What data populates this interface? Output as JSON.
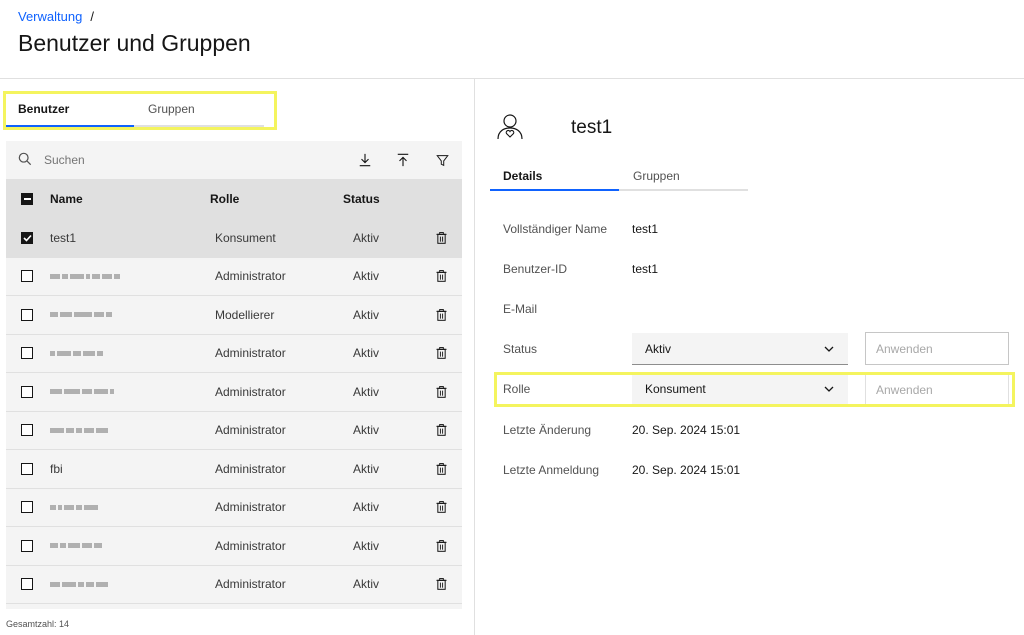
{
  "breadcrumb": {
    "root": "Verwaltung",
    "separator": "/"
  },
  "page_title": "Benutzer und Gruppen",
  "left_tabs": [
    {
      "label": "Benutzer",
      "active": true
    },
    {
      "label": "Gruppen",
      "active": false
    }
  ],
  "toolbar": {
    "search_placeholder": "Suchen",
    "download_icon": "download-icon",
    "upload_icon": "upload-icon",
    "filter_icon": "filter-icon"
  },
  "table": {
    "columns": {
      "name": "Name",
      "role": "Rolle",
      "status": "Status"
    },
    "rows": [
      {
        "name": "test1",
        "role": "Konsument",
        "status": "Aktiv",
        "checked": true,
        "redacted": false
      },
      {
        "name": "",
        "role": "Administrator",
        "status": "Aktiv",
        "checked": false,
        "redacted": true
      },
      {
        "name": "",
        "role": "Modellierer",
        "status": "Aktiv",
        "checked": false,
        "redacted": true
      },
      {
        "name": "",
        "role": "Administrator",
        "status": "Aktiv",
        "checked": false,
        "redacted": true
      },
      {
        "name": "",
        "role": "Administrator",
        "status": "Aktiv",
        "checked": false,
        "redacted": true
      },
      {
        "name": "",
        "role": "Administrator",
        "status": "Aktiv",
        "checked": false,
        "redacted": true
      },
      {
        "name": "fbi",
        "role": "Administrator",
        "status": "Aktiv",
        "checked": false,
        "redacted": false
      },
      {
        "name": "",
        "role": "Administrator",
        "status": "Aktiv",
        "checked": false,
        "redacted": true
      },
      {
        "name": "",
        "role": "Administrator",
        "status": "Aktiv",
        "checked": false,
        "redacted": true
      },
      {
        "name": "",
        "role": "Administrator",
        "status": "Aktiv",
        "checked": false,
        "redacted": true
      }
    ]
  },
  "total_label": "Gesamtzahl: 14",
  "detail": {
    "user_name": "test1",
    "tabs": [
      {
        "label": "Details",
        "active": true
      },
      {
        "label": "Gruppen",
        "active": false
      }
    ],
    "fields": {
      "full_name_label": "Vollständiger Name",
      "full_name_value": "test1",
      "user_id_label": "Benutzer-ID",
      "user_id_value": "test1",
      "email_label": "E-Mail",
      "email_value": "",
      "status_label": "Status",
      "status_value": "Aktiv",
      "role_label": "Rolle",
      "role_value": "Konsument",
      "apply_placeholder": "Anwenden",
      "last_change_label": "Letzte Änderung",
      "last_change_value": "20. Sep. 2024 15:01",
      "last_login_label": "Letzte Anmeldung",
      "last_login_value": "20. Sep. 2024 15:01"
    }
  },
  "colors": {
    "accent": "#0f62fe",
    "highlight": "#f4f45e"
  }
}
